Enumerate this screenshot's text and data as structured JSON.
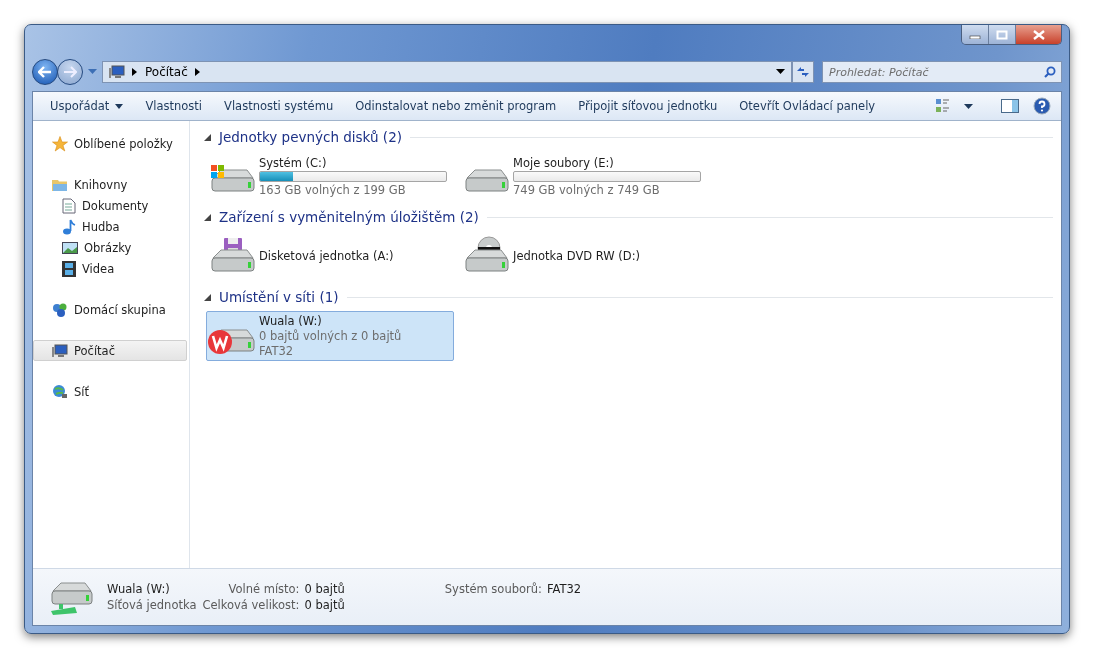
{
  "address": {
    "crumbs": [
      "Počítač"
    ]
  },
  "search": {
    "placeholder": "Prohledat: Počítač"
  },
  "toolbar": {
    "items": [
      {
        "label": "Uspořádat",
        "dropdown": true
      },
      {
        "label": "Vlastnosti",
        "dropdown": false
      },
      {
        "label": "Vlastnosti systému",
        "dropdown": false
      },
      {
        "label": "Odinstalovat nebo změnit program",
        "dropdown": false
      },
      {
        "label": "Připojit síťovou jednotku",
        "dropdown": false
      },
      {
        "label": "Otevřít Ovládací panely",
        "dropdown": false
      }
    ]
  },
  "sidebar": {
    "items": [
      {
        "label": "Oblíbené položky",
        "kind": "star",
        "selected": false
      },
      {
        "label": "Knihovny",
        "kind": "folder",
        "selected": false,
        "children": [
          {
            "label": "Dokumenty",
            "kind": "document",
            "selected": false
          },
          {
            "label": "Hudba",
            "kind": "music",
            "selected": false
          },
          {
            "label": "Obrázky",
            "kind": "picture",
            "selected": false
          },
          {
            "label": "Videa",
            "kind": "film",
            "selected": false
          }
        ]
      },
      {
        "label": "Domácí skupina",
        "kind": "homegroup",
        "selected": false
      },
      {
        "label": "Počítač",
        "kind": "computer",
        "selected": true
      },
      {
        "label": "Síť",
        "kind": "network",
        "selected": false
      }
    ]
  },
  "sections": [
    {
      "title": "Jednotky pevných disků (2)",
      "expanded": true,
      "drives": [
        {
          "name": "Systém (C:)",
          "kind": "system",
          "level": 0.18,
          "free": "163 GB volných z 199 GB",
          "selected": false
        },
        {
          "name": "Moje soubory (E:)",
          "kind": "disk",
          "level": 0,
          "free": "749 GB volných z 749 GB",
          "selected": false
        }
      ]
    },
    {
      "title": "Zařízení s vyměnitelným úložištěm (2)",
      "expanded": true,
      "drives": [
        {
          "name": "Disketová jednotka (A:)",
          "kind": "floppy",
          "selected": false
        },
        {
          "name": "Jednotka DVD RW (D:)",
          "kind": "dvd",
          "selected": false
        }
      ]
    },
    {
      "title": "Umístění v síti (1)",
      "expanded": true,
      "drives": [
        {
          "name": "Wuala (W:)",
          "kind": "network",
          "free": "0 bajtů volných z 0 bajtů",
          "filesystem": "FAT32",
          "selected": true
        }
      ]
    }
  ],
  "details": {
    "name": "Wuala (W:)",
    "type": "Síťová jednotka",
    "fields": [
      {
        "label": "Volné místo:",
        "value": "0 bajtů"
      },
      {
        "label": "Celková velikost:",
        "value": "0 bajtů"
      },
      {
        "label": "Systém souborů:",
        "value": "FAT32"
      }
    ]
  }
}
